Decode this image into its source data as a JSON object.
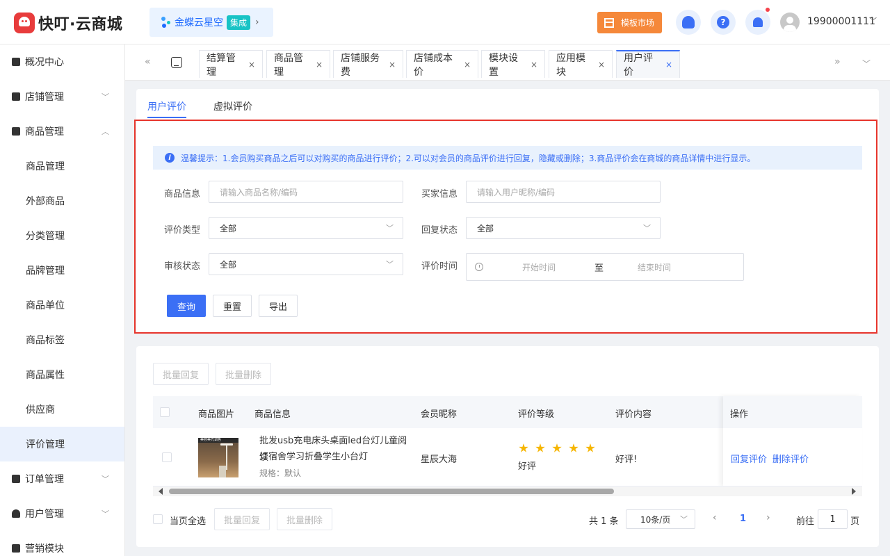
{
  "header": {
    "logo_text": "快叮·云商城",
    "kd_name": "金蝶云星空",
    "kd_tag": "集成",
    "kd_arrow": "›",
    "template_market": "模板市场",
    "help_glyph": "?",
    "username": "19900001111"
  },
  "sidebar": {
    "items": [
      {
        "label": "概况中心"
      },
      {
        "label": "店铺管理"
      },
      {
        "label": "商品管理"
      },
      {
        "label": "商品管理"
      },
      {
        "label": "外部商品"
      },
      {
        "label": "分类管理"
      },
      {
        "label": "品牌管理"
      },
      {
        "label": "商品单位"
      },
      {
        "label": "商品标签"
      },
      {
        "label": "商品属性"
      },
      {
        "label": "供应商"
      },
      {
        "label": "评价管理"
      },
      {
        "label": "订单管理"
      },
      {
        "label": "用户管理"
      },
      {
        "label": "营销模块"
      }
    ]
  },
  "tabs": {
    "items": [
      {
        "label": "结算管理"
      },
      {
        "label": "商品管理"
      },
      {
        "label": "店铺服务费"
      },
      {
        "label": "店铺成本价"
      },
      {
        "label": "模块设置"
      },
      {
        "label": "应用模块"
      },
      {
        "label": "用户评价"
      }
    ],
    "close_glyph": "×"
  },
  "subtabs": {
    "user_review": "用户评价",
    "virtual_review": "虚拟评价"
  },
  "tip": {
    "icon_glyph": "i",
    "text": "温馨提示：1.会员购买商品之后可以对购买的商品进行评价；2.可以对会员的商品评价进行回复，隐藏或删除；3.商品评价会在商城的商品详情中进行显示。"
  },
  "filters": {
    "product_info_label": "商品信息",
    "product_info_placeholder": "请输入商品名称/编码",
    "buyer_info_label": "买家信息",
    "buyer_info_placeholder": "请输入用户昵称/编码",
    "review_type_label": "评价类型",
    "review_type_value": "全部",
    "reply_status_label": "回复状态",
    "reply_status_value": "全部",
    "audit_status_label": "审核状态",
    "audit_status_value": "全部",
    "review_time_label": "评价时间",
    "start_time_placeholder": "开始时间",
    "range_separator": "至",
    "end_time_placeholder": "结束时间"
  },
  "actions": {
    "query": "查询",
    "reset": "重置",
    "export": "导出",
    "batch_reply": "批量回复",
    "batch_delete": "批量删除"
  },
  "table": {
    "headers": {
      "image": "商品图片",
      "info": "商品信息",
      "member": "会员昵称",
      "rating": "评价等级",
      "content": "评价内容",
      "operation": "操作"
    },
    "rows": [
      {
        "image_banner": "美容美光调色",
        "title_line1": "批发usb充电床头桌面led台灯儿童阅读",
        "title_line2": "灯宿舍学习折叠学生小台灯",
        "spec": "规格：默认",
        "member": "星辰大海",
        "stars": 5,
        "rating_text": "好评",
        "content": "好评!",
        "reply_link": "回复评价",
        "delete_link": "删除评价"
      }
    ]
  },
  "footer": {
    "select_all": "当页全选",
    "batch_reply": "批量回复",
    "batch_delete": "批量删除",
    "total": "共 1 条",
    "page_size": "10条/页",
    "prev": "‹",
    "current_page": "1",
    "next": "›",
    "goto_label": "前往",
    "goto_value": "1",
    "page_suffix": "页"
  }
}
